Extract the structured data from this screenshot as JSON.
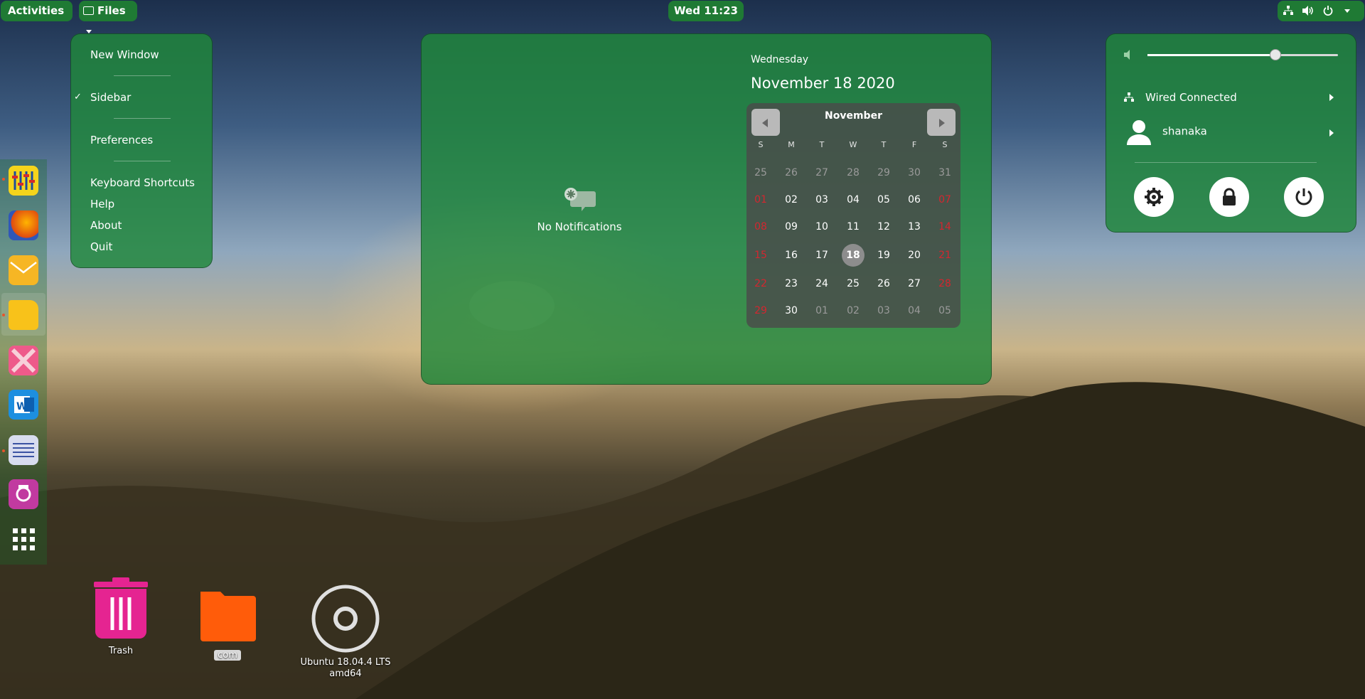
{
  "topbar": {
    "activities": "Activities",
    "app_name": "Files",
    "clock": "Wed 11:23",
    "status_icons": [
      "network-icon",
      "volume-icon",
      "power-icon"
    ]
  },
  "app_menu": {
    "items": [
      {
        "label": "New Window"
      },
      {
        "label": "Sidebar",
        "checked": true
      },
      {
        "label": "Preferences"
      },
      {
        "label": "Keyboard Shortcuts"
      },
      {
        "label": "Help"
      },
      {
        "label": "About"
      },
      {
        "label": "Quit"
      }
    ]
  },
  "calendar": {
    "notifications": "No Notifications",
    "weekday": "Wednesday",
    "date": "November 18 2020",
    "month": "November",
    "day_headers": [
      "S",
      "M",
      "T",
      "W",
      "T",
      "F",
      "S"
    ],
    "weeks": [
      [
        "25",
        "26",
        "27",
        "28",
        "29",
        "30",
        "31"
      ],
      [
        "01",
        "02",
        "03",
        "04",
        "05",
        "06",
        "07"
      ],
      [
        "08",
        "09",
        "10",
        "11",
        "12",
        "13",
        "14"
      ],
      [
        "15",
        "16",
        "17",
        "18",
        "19",
        "20",
        "21"
      ],
      [
        "22",
        "23",
        "24",
        "25",
        "26",
        "27",
        "28"
      ],
      [
        "29",
        "30",
        "01",
        "02",
        "03",
        "04",
        "05"
      ]
    ],
    "today": "18"
  },
  "system_menu": {
    "volume_level": 0.67,
    "network": "Wired Connected",
    "user": "shanaka",
    "buttons": [
      "settings-icon",
      "lock-icon",
      "power-icon"
    ]
  },
  "dock": {
    "apps": [
      "mixer-app",
      "firefox",
      "mail",
      "files",
      "xorg-app",
      "word-processor",
      "text-editor",
      "screen-recorder",
      "show-applications"
    ]
  },
  "desktop": {
    "icons": [
      {
        "label": "Trash"
      },
      {
        "label": "com"
      },
      {
        "label": "Ubuntu 18.04.4 LTS amd64"
      }
    ]
  },
  "colors": {
    "accent": "#1f7a34",
    "weekend": "#d3262f"
  }
}
